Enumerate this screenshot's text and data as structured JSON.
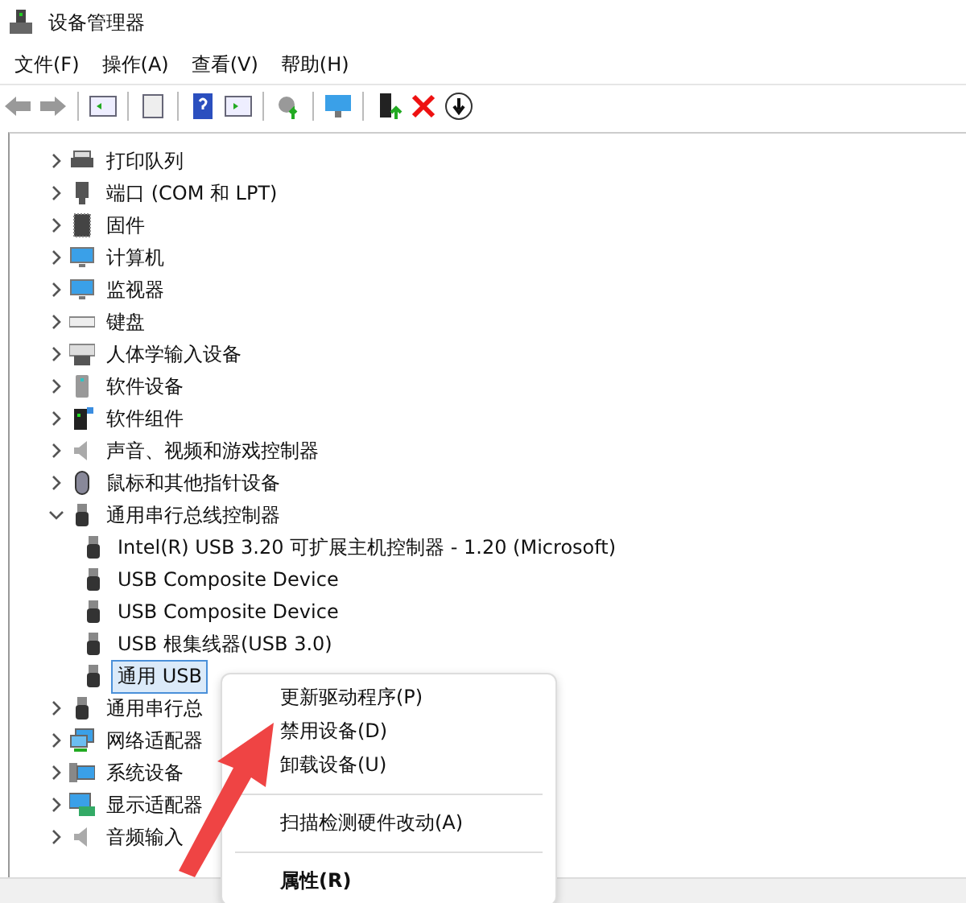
{
  "window": {
    "title": "设备管理器"
  },
  "menu": [
    "文件(F)",
    "操作(A)",
    "查看(V)",
    "帮助(H)"
  ],
  "tree": [
    {
      "label": "打印队列",
      "expanded": false,
      "selected": false
    },
    {
      "label": "端口 (COM 和 LPT)",
      "expanded": false,
      "selected": false
    },
    {
      "label": "固件",
      "expanded": false,
      "selected": false
    },
    {
      "label": "计算机",
      "expanded": false,
      "selected": false
    },
    {
      "label": "监视器",
      "expanded": false,
      "selected": false
    },
    {
      "label": "键盘",
      "expanded": false,
      "selected": false
    },
    {
      "label": "人体学输入设备",
      "expanded": false,
      "selected": false
    },
    {
      "label": "软件设备",
      "expanded": false,
      "selected": false
    },
    {
      "label": "软件组件",
      "expanded": false,
      "selected": false
    },
    {
      "label": "声音、视频和游戏控制器",
      "expanded": false,
      "selected": false
    },
    {
      "label": "鼠标和其他指针设备",
      "expanded": false,
      "selected": false
    },
    {
      "label": "通用串行总线控制器",
      "expanded": true,
      "selected": false,
      "children": [
        {
          "label": "Intel(R) USB 3.20 可扩展主机控制器 - 1.20 (Microsoft)",
          "selected": false
        },
        {
          "label": "USB Composite Device",
          "selected": false
        },
        {
          "label": "USB Composite Device",
          "selected": false
        },
        {
          "label": "USB 根集线器(USB 3.0)",
          "selected": false
        },
        {
          "label": "通用 USB",
          "selected": true
        }
      ]
    },
    {
      "label": "通用串行总",
      "expanded": false,
      "selected": false
    },
    {
      "label": "网络适配器",
      "expanded": false,
      "selected": false
    },
    {
      "label": "系统设备",
      "expanded": false,
      "selected": false
    },
    {
      "label": "显示适配器",
      "expanded": false,
      "selected": false
    },
    {
      "label": "音频输入",
      "expanded": false,
      "selected": false
    }
  ],
  "context_menu": [
    {
      "kind": "item",
      "label": "更新驱动程序(P)",
      "default": false
    },
    {
      "kind": "item",
      "label": "禁用设备(D)",
      "default": false
    },
    {
      "kind": "item",
      "label": "卸载设备(U)",
      "default": false
    },
    {
      "kind": "separator"
    },
    {
      "kind": "item",
      "label": "扫描检测硬件改动(A)",
      "default": false
    },
    {
      "kind": "separator"
    },
    {
      "kind": "item",
      "label": "属性(R)",
      "default": true
    }
  ]
}
